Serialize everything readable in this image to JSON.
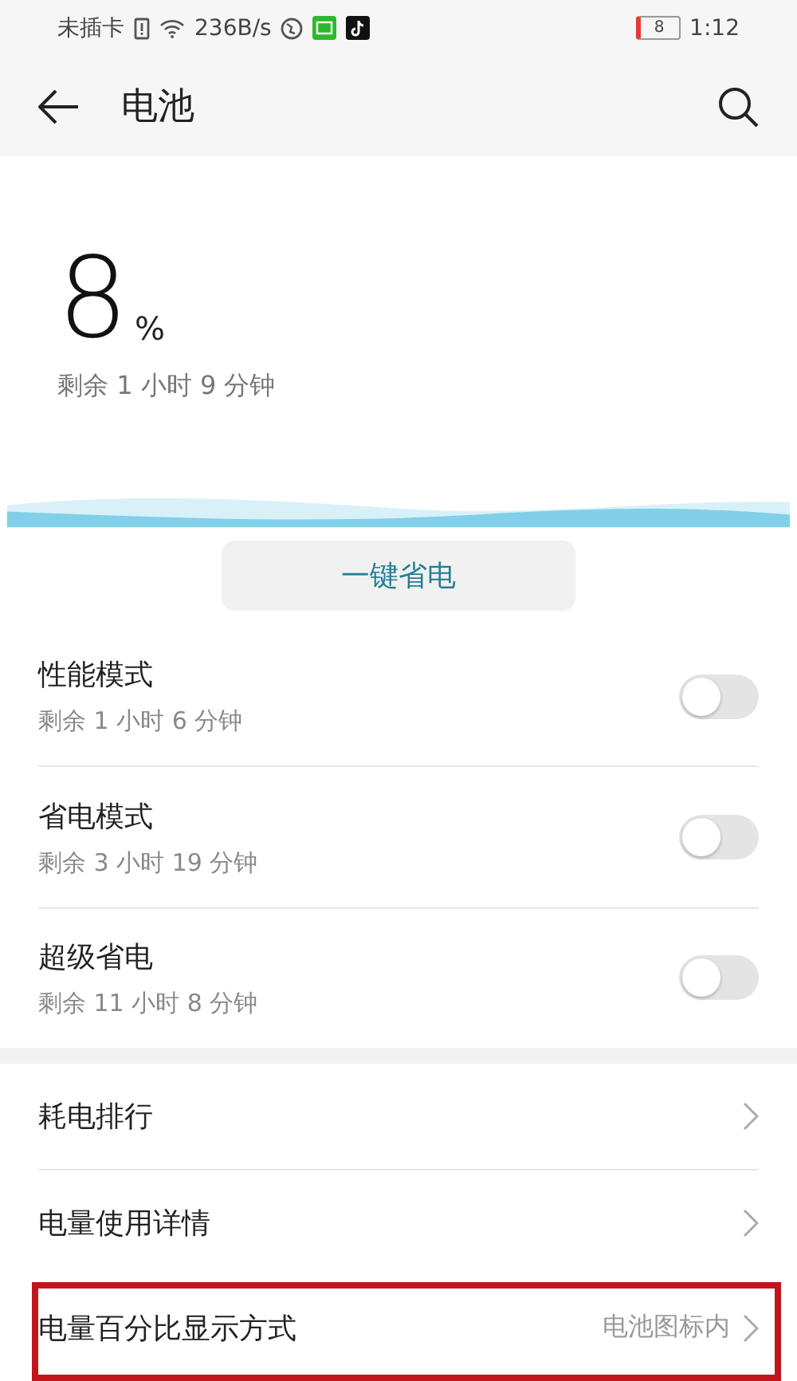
{
  "status_bar": {
    "carrier": "未插卡",
    "speed": "236B/s",
    "battery": "8",
    "time": "1:12"
  },
  "header": {
    "title": "电池"
  },
  "battery": {
    "percent": "8",
    "unit": "%",
    "remaining": "剩余 1 小时 9 分钟"
  },
  "save_button": "一键省电",
  "modes": [
    {
      "title": "性能模式",
      "subtitle": "剩余 1 小时 6 分钟",
      "on": false
    },
    {
      "title": "省电模式",
      "subtitle": "剩余 3 小时 19 分钟",
      "on": false
    },
    {
      "title": "超级省电",
      "subtitle": "剩余 11 小时 8 分钟",
      "on": false
    }
  ],
  "links": [
    {
      "label": "耗电排行",
      "highlighted": false
    },
    {
      "label": "电量使用详情",
      "highlighted": false
    },
    {
      "label": "电量百分比显示方式",
      "value": "电池图标内",
      "highlighted": true
    }
  ]
}
